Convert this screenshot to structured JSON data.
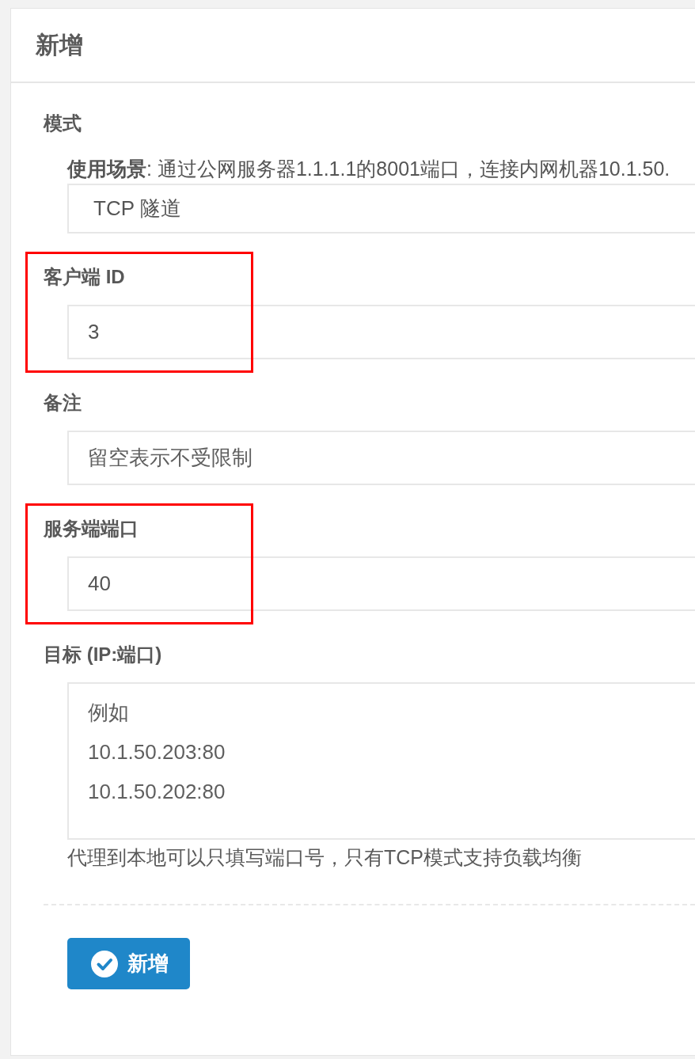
{
  "panel": {
    "title": "新增"
  },
  "form": {
    "fields": [
      {
        "kind": "select",
        "label": "模式",
        "description": "**使用场景**: 通过公网服务器1.1.1.1的8001端口，连接内网机器10.1.50.",
        "value": "TCP 隧道",
        "highlighted": false
      },
      {
        "kind": "input",
        "label": "客户端 ID",
        "value": "3",
        "highlighted": true
      },
      {
        "kind": "input",
        "label": "备注",
        "placeholder": "留空表示不受限制",
        "highlighted": false
      },
      {
        "kind": "input",
        "label": "服务端端口",
        "value": "40",
        "highlighted": true
      },
      {
        "kind": "textarea",
        "label": "目标 (IP:端口)",
        "placeholder": "例如\n10.1.50.203:80\n10.1.50.202:80",
        "help": "代理到本地可以只填写端口号，只有TCP模式支持负载均衡",
        "highlighted": false
      }
    ]
  },
  "submit_button": {
    "label": "新增"
  }
}
